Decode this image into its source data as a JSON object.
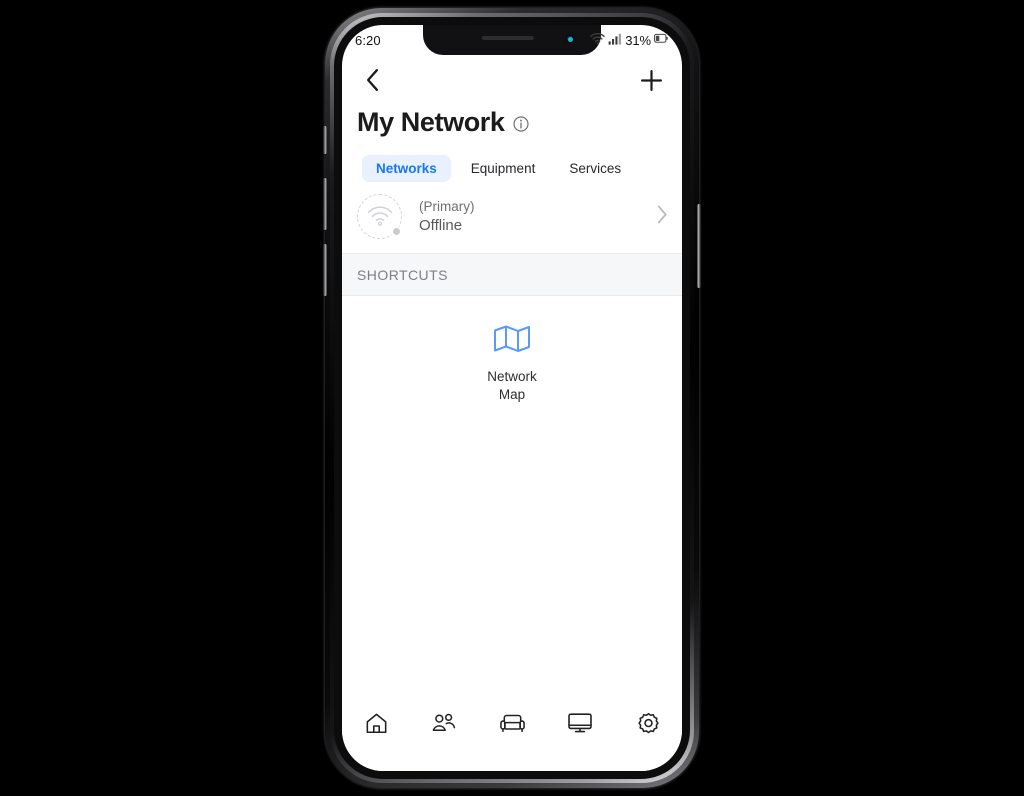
{
  "device": {
    "type": "smartphone-mockup",
    "notch": {
      "camera_color": "#17b6cf"
    }
  },
  "status_bar": {
    "time": "6:20",
    "battery_percent": "31%",
    "icons": [
      "wifi-icon",
      "cellular-signal-icon",
      "battery-icon"
    ]
  },
  "app_bar": {
    "back_label": "‹",
    "add_label": "+",
    "back_icon": "chevron-left-icon",
    "add_icon": "plus-icon"
  },
  "header": {
    "title": "My Network",
    "info_icon": "info-circle-icon"
  },
  "tabs": {
    "active_index": 0,
    "items": [
      {
        "label": "Networks",
        "active": true
      },
      {
        "label": "Equipment",
        "active": false
      },
      {
        "label": "Services",
        "active": false
      }
    ]
  },
  "network_row": {
    "name": "(Primary)",
    "status": "Offline",
    "status_color": "#c9cbcf",
    "icon": "wifi-icon",
    "chevron": "chevron-right-icon"
  },
  "shortcuts_section": {
    "header": "SHORTCUTS",
    "items": [
      {
        "label": "Network\nMap",
        "icon": "map-icon",
        "color": "#5b9bf5"
      }
    ]
  },
  "bottom_nav": {
    "items": [
      {
        "name": "home",
        "icon": "home-icon"
      },
      {
        "name": "people",
        "icon": "people-icon"
      },
      {
        "name": "places",
        "icon": "sofa-icon"
      },
      {
        "name": "devices",
        "icon": "monitor-icon"
      },
      {
        "name": "settings",
        "icon": "gear-icon"
      }
    ]
  },
  "colors": {
    "accent_blue": "#1877f2",
    "tab_active_bg": "#eaf1fe",
    "map_icon_blue": "#5b9bf5",
    "section_bg": "#f6f7f9",
    "muted_text": "#7c8085"
  }
}
